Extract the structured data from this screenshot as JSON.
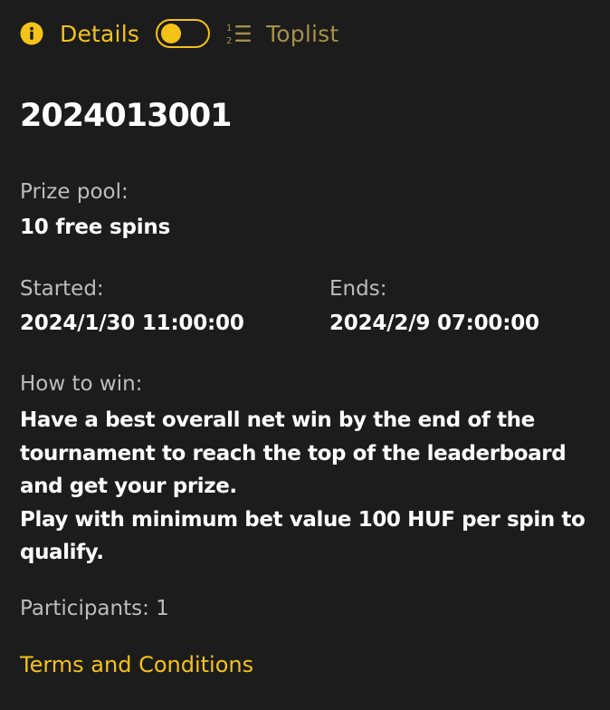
{
  "header": {
    "details_label": "Details",
    "toplist_label": "Toplist",
    "toggle_on": false,
    "accent_color": "#f5c218",
    "muted_accent_color": "#a6904a"
  },
  "tournament": {
    "id": "2024013001",
    "prize_pool_label": "Prize pool:",
    "prize_pool_value": "10 free spins",
    "started_label": "Started:",
    "started_value": "2024/1/30 11:00:00",
    "ends_label": "Ends:",
    "ends_value": "2024/2/9 07:00:00",
    "how_to_win_label": "How to win:",
    "how_to_win_line1": "Have a best overall net win by the end of the tournament to reach the top of the leaderboard and get your prize.",
    "how_to_win_line2": "Play with minimum bet value 100 HUF per spin to qualify.",
    "participants_text": "Participants: 1",
    "terms_link": "Terms and Conditions"
  },
  "icons": {
    "details": "info-icon",
    "toplist": "numbered-list-icon"
  }
}
